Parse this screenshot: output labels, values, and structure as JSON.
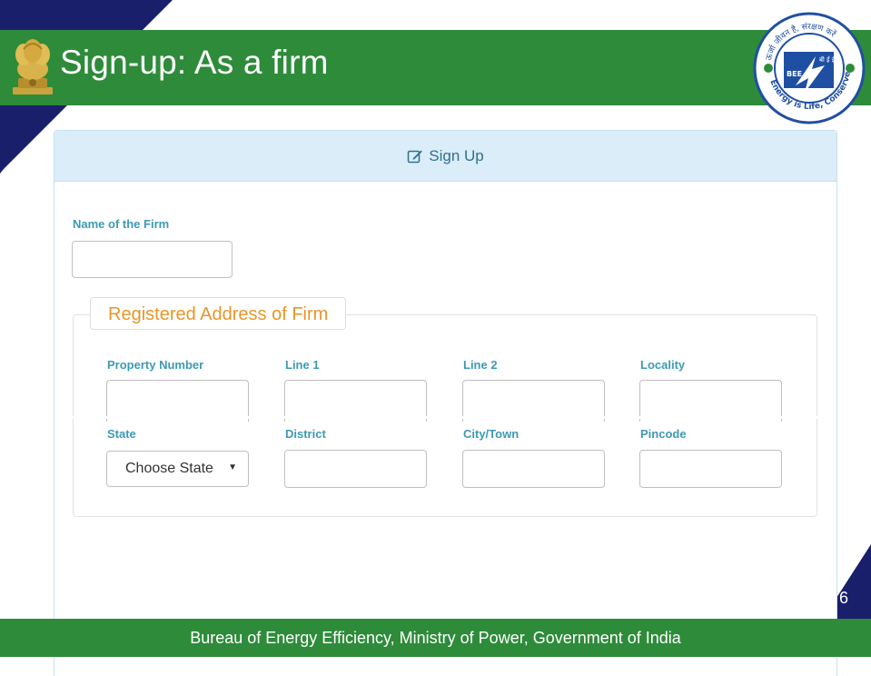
{
  "slide": {
    "title": "Sign-up: As a firm",
    "page_number": "6",
    "footer": "Bureau of Energy Efficiency, Ministry of Power, Government of India"
  },
  "logo": {
    "name": "Bureau of Energy Efficiency logo",
    "text_top": "ऊर्जा जीवन है, संरक्षण करें",
    "text_abbr_hindi": "बी ई ई",
    "text_abbr": "BEE",
    "text_bottom": "Energy is Life, Conserve it"
  },
  "colors": {
    "header_green": "#2e8b3a",
    "navy": "#1a1f6b",
    "panel_heading_bg": "#daedf8",
    "label_color": "#3d9ab5",
    "legend_orange": "#e8962a"
  },
  "form": {
    "heading_icon": "edit-icon",
    "heading": "Sign Up",
    "firm_name_label": "Name of the Firm",
    "firm_name_value": "",
    "address_legend": "Registered Address of Firm",
    "fields": {
      "property_number": {
        "label": "Property Number",
        "value": ""
      },
      "line1": {
        "label": "Line 1",
        "value": ""
      },
      "line2": {
        "label": "Line 2",
        "value": ""
      },
      "locality": {
        "label": "Locality",
        "value": ""
      },
      "state": {
        "label": "State",
        "selected": "Choose State"
      },
      "district": {
        "label": "District",
        "value": ""
      },
      "city_town": {
        "label": "City/Town",
        "value": ""
      },
      "pincode": {
        "label": "Pincode",
        "value": ""
      }
    }
  }
}
